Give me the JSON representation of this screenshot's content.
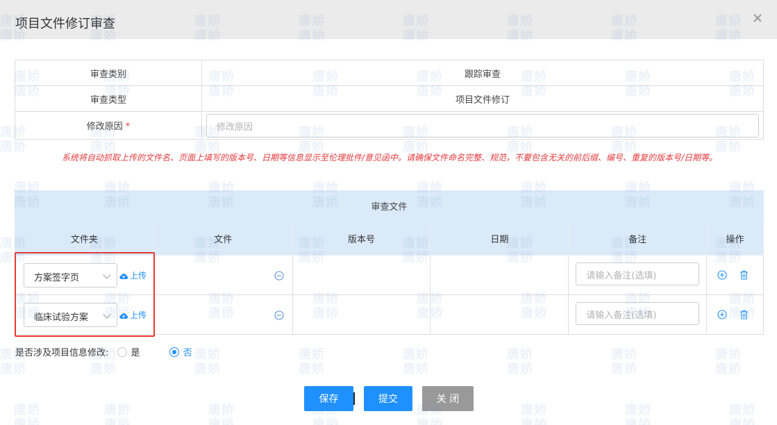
{
  "dialog": {
    "title": "项目文件修订审查"
  },
  "info": {
    "rows": [
      {
        "label": "审查类别",
        "value": "跟踪审查"
      },
      {
        "label": "审查类型",
        "value": "项目文件修订"
      }
    ],
    "reason": {
      "label": "修改原因",
      "required_mark": "*",
      "placeholder": "修改原因",
      "value": ""
    }
  },
  "warning": "系统将自动抓取上传的文件名、页面上填写的版本号、日期等信息显示至伦理批件/意见函中。请确保文件命名完整、规范，不要包含无关的前后缀、编号、重复的版本号/日期等。",
  "files_table": {
    "caption": "审查文件",
    "headers": [
      "文件夹",
      "文件",
      "版本号",
      "日期",
      "备注",
      "操作"
    ],
    "upload_label": "上传",
    "note_placeholder": "请输入备注(选填)",
    "rows": [
      {
        "folder": "方案签字页",
        "file": "",
        "version": "",
        "date": "",
        "note": ""
      },
      {
        "folder": "临床试验方案",
        "file": "",
        "version": "",
        "date": "",
        "note": ""
      }
    ]
  },
  "project_info_change": {
    "label": "是否涉及项目信息修改:",
    "options": [
      {
        "label": "是",
        "selected": false
      },
      {
        "label": "否",
        "selected": true
      }
    ]
  },
  "buttons": {
    "save": "保存",
    "submit": "提交",
    "close": "关 闭"
  },
  "watermark_text": [
    "唐娇",
    "唐娇"
  ],
  "colors": {
    "accent": "#1e90ff",
    "required": "#e4393c",
    "highlight_box": "#e83a2d",
    "table_header": "#dbeaf9",
    "close_button": "#999999"
  }
}
